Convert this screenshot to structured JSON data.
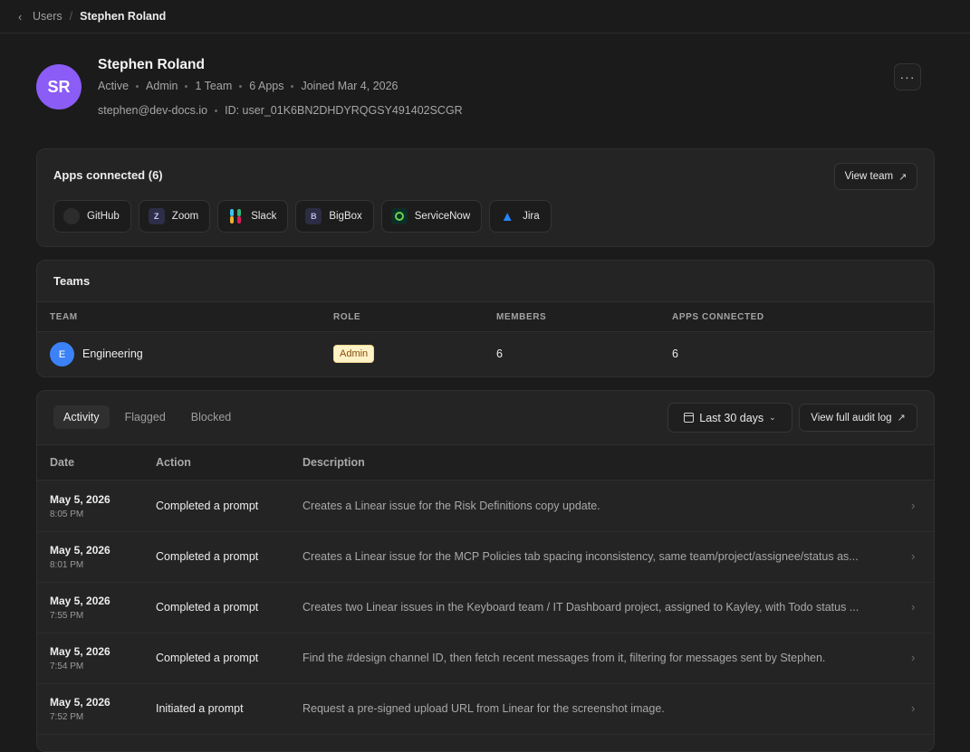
{
  "breadcrumb": {
    "parent": "Users",
    "separator": "/",
    "current": "Stephen Roland"
  },
  "user": {
    "initials": "SR",
    "name": "Stephen Roland",
    "status": "Active",
    "role": "Admin",
    "teams": "1 Team",
    "apps": "6 Apps",
    "joined": "Joined Mar 4, 2026",
    "email": "stephen@dev-docs.io",
    "id": "ID: user_01K6BN2DHDYRQGSY491402SCGR",
    "more": "···",
    "avatar_color": "#8b5cf6"
  },
  "apps_card": {
    "title": "Apps connected (6)",
    "view_team": "View team",
    "apps": [
      {
        "name": "GitHub",
        "icon": "github-icon"
      },
      {
        "name": "Zoom",
        "icon": "zoom-icon",
        "glyph": "Z"
      },
      {
        "name": "Slack",
        "icon": "slack-icon"
      },
      {
        "name": "BigBox",
        "icon": "bigbox-icon",
        "glyph": "B"
      },
      {
        "name": "ServiceNow",
        "icon": "servicenow-icon"
      },
      {
        "name": "Jira",
        "icon": "jira-icon"
      }
    ]
  },
  "teams": {
    "title": "Teams",
    "columns": [
      "TEAM",
      "ROLE",
      "MEMBERS",
      "APPS CONNECTED"
    ],
    "rows": [
      {
        "initial": "E",
        "name": "Engineering",
        "role": "Admin",
        "members": "6",
        "apps": "6"
      }
    ]
  },
  "activity": {
    "tabs": [
      "Activity",
      "Flagged",
      "Blocked"
    ],
    "active_tab": "Activity",
    "date_filter": "Last 30 days",
    "audit_link": "View full audit log",
    "columns": [
      "Date",
      "Action",
      "Description"
    ],
    "rows": [
      {
        "date": "May 5, 2026",
        "time": "8:05 PM",
        "action": "Completed a prompt",
        "description": "Creates a Linear issue for the Risk Definitions copy update."
      },
      {
        "date": "May 5, 2026",
        "time": "8:01 PM",
        "action": "Completed a prompt",
        "description": "Creates a Linear issue for the MCP Policies tab spacing inconsistency, same team/project/assignee/status as..."
      },
      {
        "date": "May 5, 2026",
        "time": "7:55 PM",
        "action": "Completed a prompt",
        "description": "Creates two Linear issues in the Keyboard team / IT Dashboard project, assigned to Kayley, with Todo status ..."
      },
      {
        "date": "May 5, 2026",
        "time": "7:54 PM",
        "action": "Completed a prompt",
        "description": "Find the #design channel ID, then fetch recent messages from it, filtering for messages sent by Stephen."
      },
      {
        "date": "May 5, 2026",
        "time": "7:52 PM",
        "action": "Initiated a prompt",
        "description": "Request a pre-signed upload URL from Linear for the screenshot image."
      }
    ]
  }
}
